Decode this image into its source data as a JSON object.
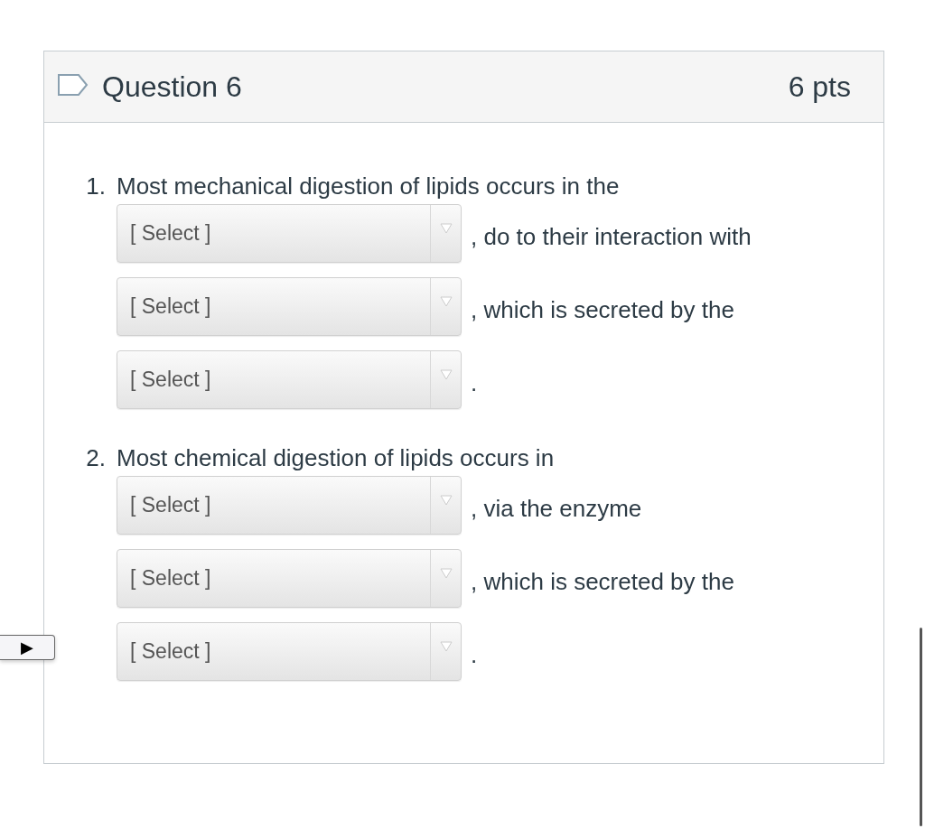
{
  "question": {
    "title": "Question 6",
    "points": "6 pts"
  },
  "items": [
    {
      "number": "1.",
      "text": "Most mechanical digestion of lipids occurs in the",
      "blanks": [
        {
          "value": "[ Select ]",
          "after": ", do to their interaction with"
        },
        {
          "value": "[ Select ]",
          "after": ", which is secreted by the"
        },
        {
          "value": "[ Select ]",
          "after": "."
        }
      ]
    },
    {
      "number": "2.",
      "text": "Most chemical digestion of lipids occurs in",
      "blanks": [
        {
          "value": "[ Select ]",
          "after": ", via the enzyme"
        },
        {
          "value": "[ Select ]",
          "after": ", which is secreted by the"
        },
        {
          "value": "[ Select ]",
          "after": "."
        }
      ]
    }
  ],
  "side_button": {
    "label": "▶"
  }
}
